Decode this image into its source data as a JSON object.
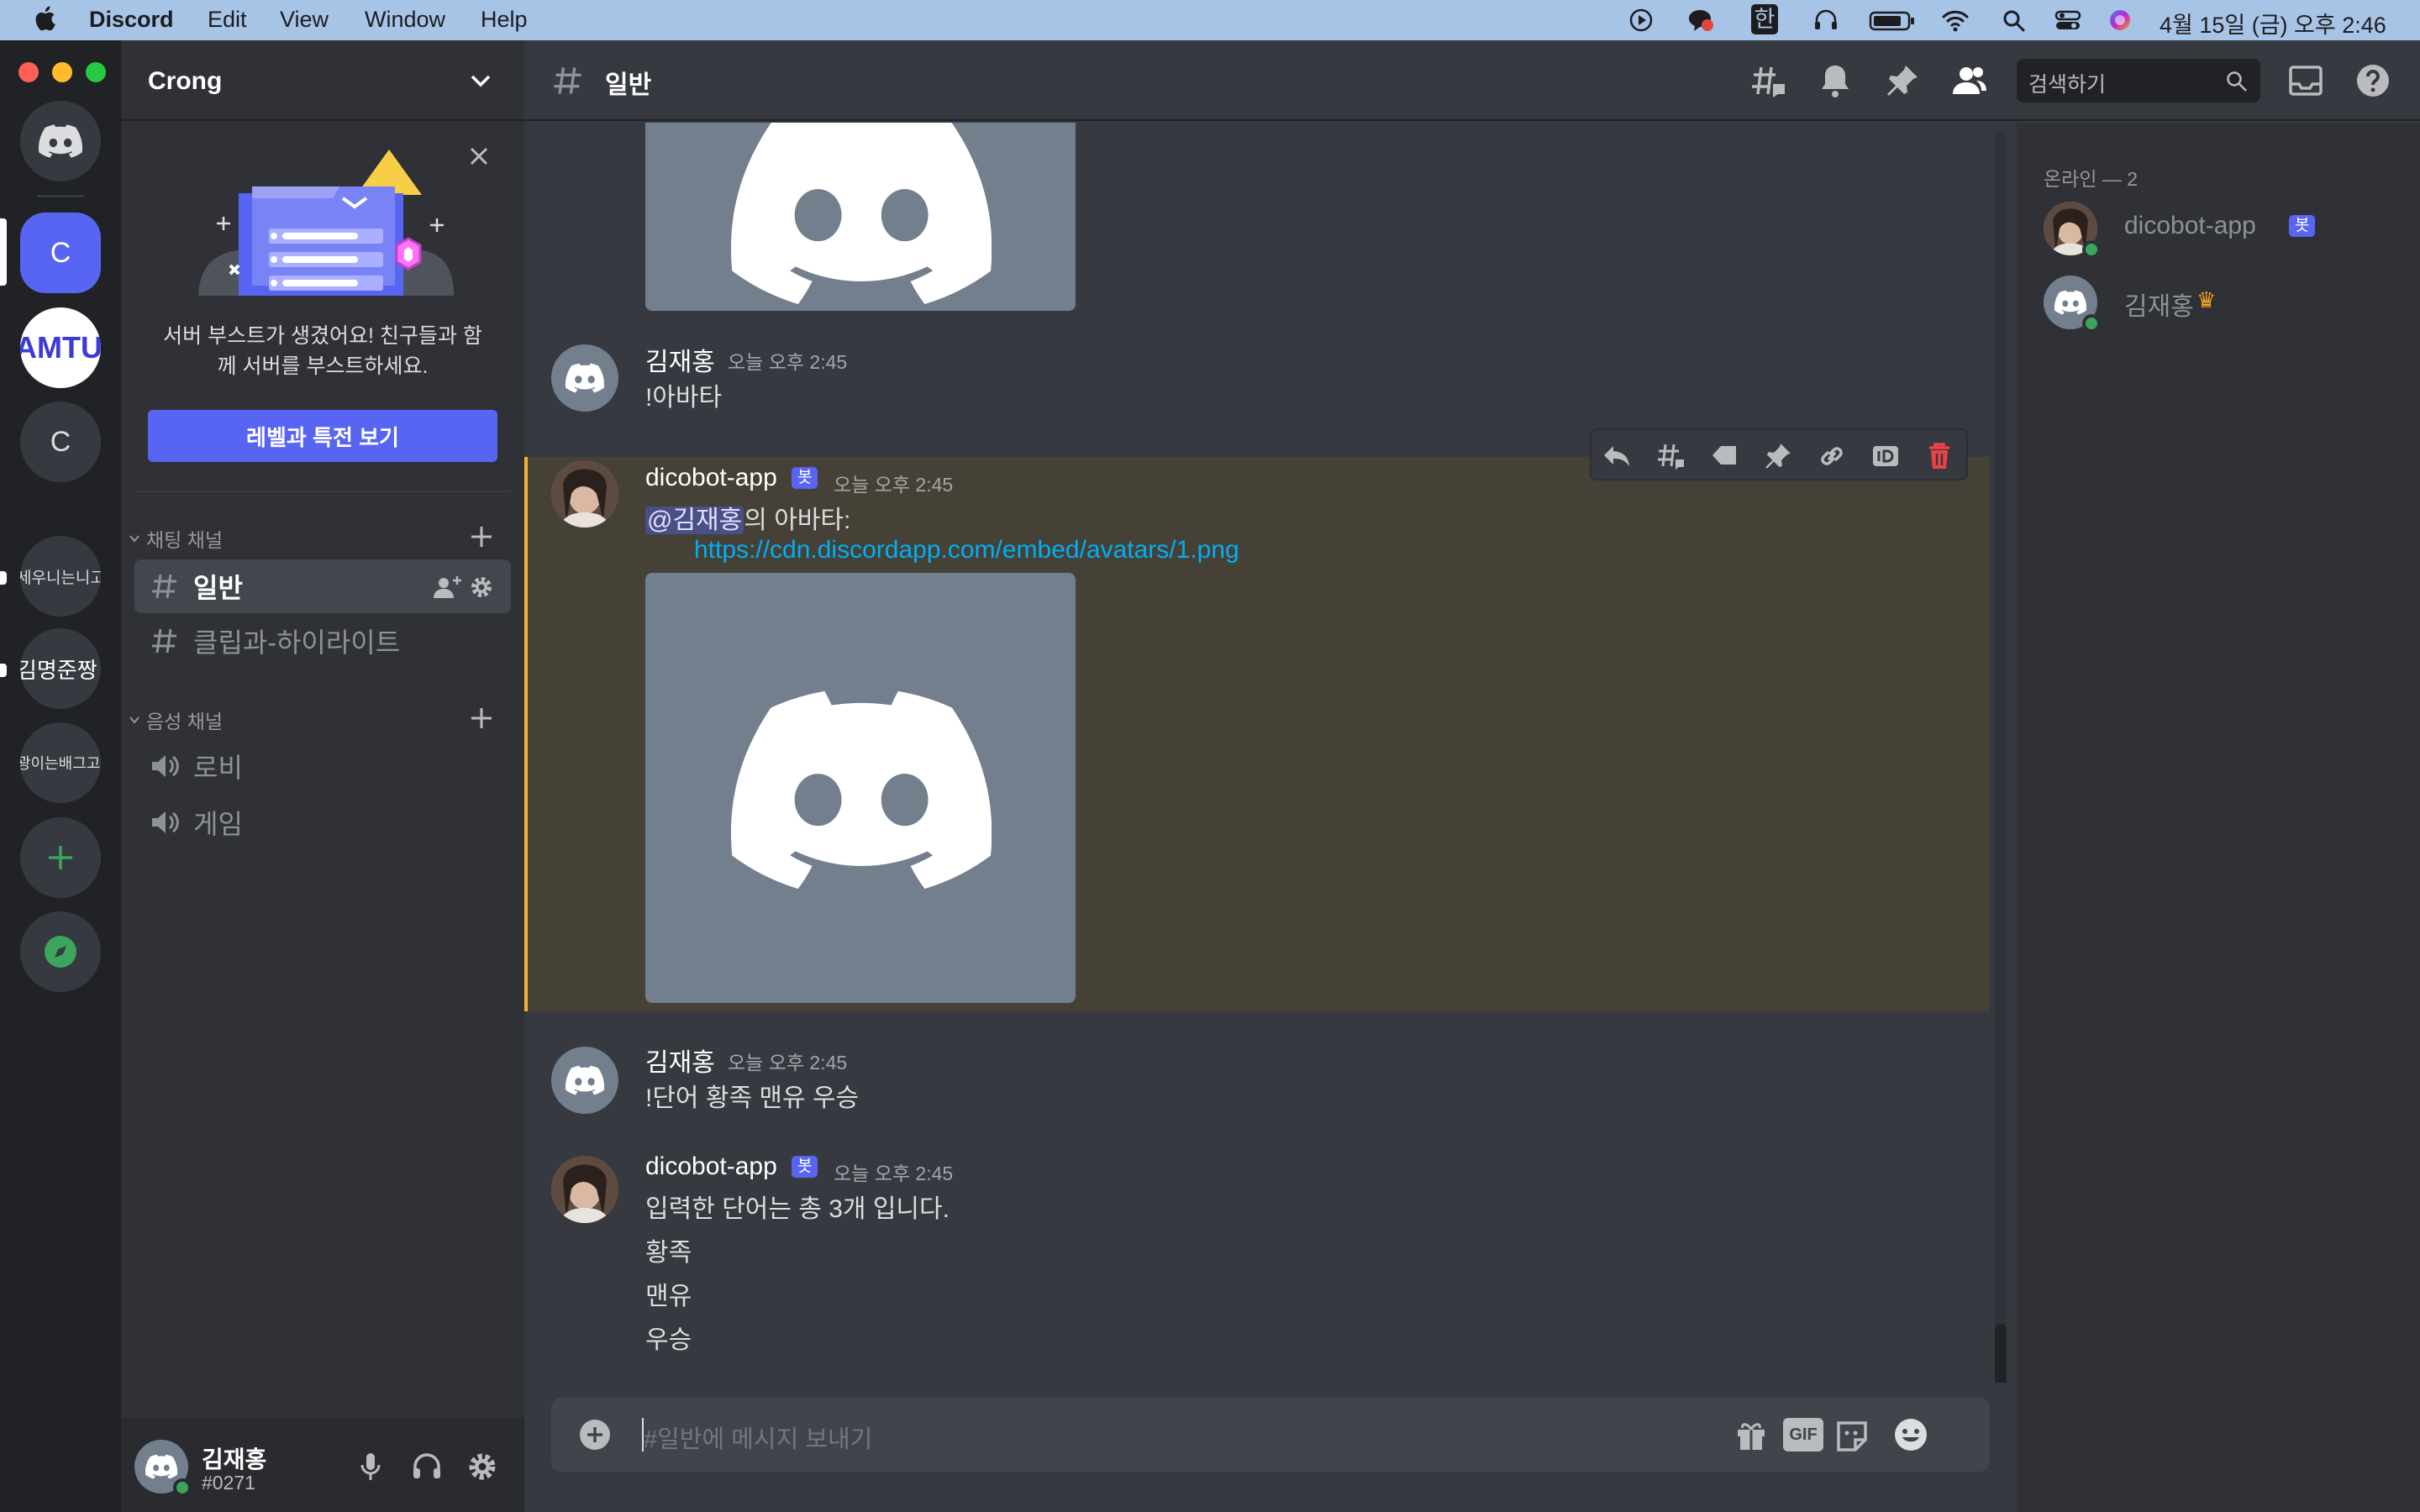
{
  "menubar": {
    "app": "Discord",
    "items": [
      "Edit",
      "View",
      "Window",
      "Help"
    ],
    "input_method": "한",
    "datetime": "4월 15일 (금) 오후 2:46"
  },
  "servers": [
    {
      "label": "C"
    },
    {
      "label": "AMTU"
    },
    {
      "label": "C"
    },
    {
      "label": "세우니는니고수"
    },
    {
      "label": "김명준짱"
    },
    {
      "label": "광이는배그고"
    }
  ],
  "guild": {
    "name": "Crong"
  },
  "boost": {
    "text_line1": "서버 부스트가 생겼어요! 친구들과 함",
    "text_line2": "께 서버를 부스트하세요.",
    "button": "레벨과 특전 보기"
  },
  "categories": {
    "text": "채팅 채널",
    "voice": "음성 채널"
  },
  "channels": {
    "text": [
      {
        "name": "일반"
      },
      {
        "name": "클립과-하이라이트"
      }
    ],
    "voice": [
      {
        "name": "로비"
      },
      {
        "name": "게임"
      }
    ]
  },
  "user": {
    "name": "김재홍",
    "tag": "#0271"
  },
  "header": {
    "channel": "일반",
    "search_placeholder": "검색하기"
  },
  "messages": [
    {
      "author": "김재홍",
      "time": "오늘 오후 2:45",
      "text": "!아바타"
    },
    {
      "author": "dicobot-app",
      "bot_tag": "봇",
      "time": "오늘 오후 2:45",
      "mention": "@김재홍",
      "text_after_mention": "의 아바타:",
      "link": "https://cdn.discordapp.com/embed/avatars/1.png"
    },
    {
      "author": "김재홍",
      "time": "오늘 오후 2:45",
      "text": "!단어 황족 맨유 우승"
    },
    {
      "author": "dicobot-app",
      "bot_tag": "봇",
      "time": "오늘 오후 2:45",
      "lines": [
        "입력한 단어는 총 3개 입니다.",
        "황족",
        "맨유",
        "우승"
      ]
    }
  ],
  "composer": {
    "placeholder": "#일반에 메시지 보내기",
    "gif_label": "GIF"
  },
  "members": {
    "heading": "온라인 — 2",
    "list": [
      {
        "name": "dicobot-app",
        "bot_tag": "봇"
      },
      {
        "name": "김재홍",
        "crown": "♛"
      }
    ]
  },
  "colors": {
    "blurple": "#5865f2",
    "online": "#3ba55d",
    "danger": "#ed4245",
    "link": "#00aff4",
    "highlight_bg": "#464137",
    "highlight_bar": "#f0b232"
  }
}
